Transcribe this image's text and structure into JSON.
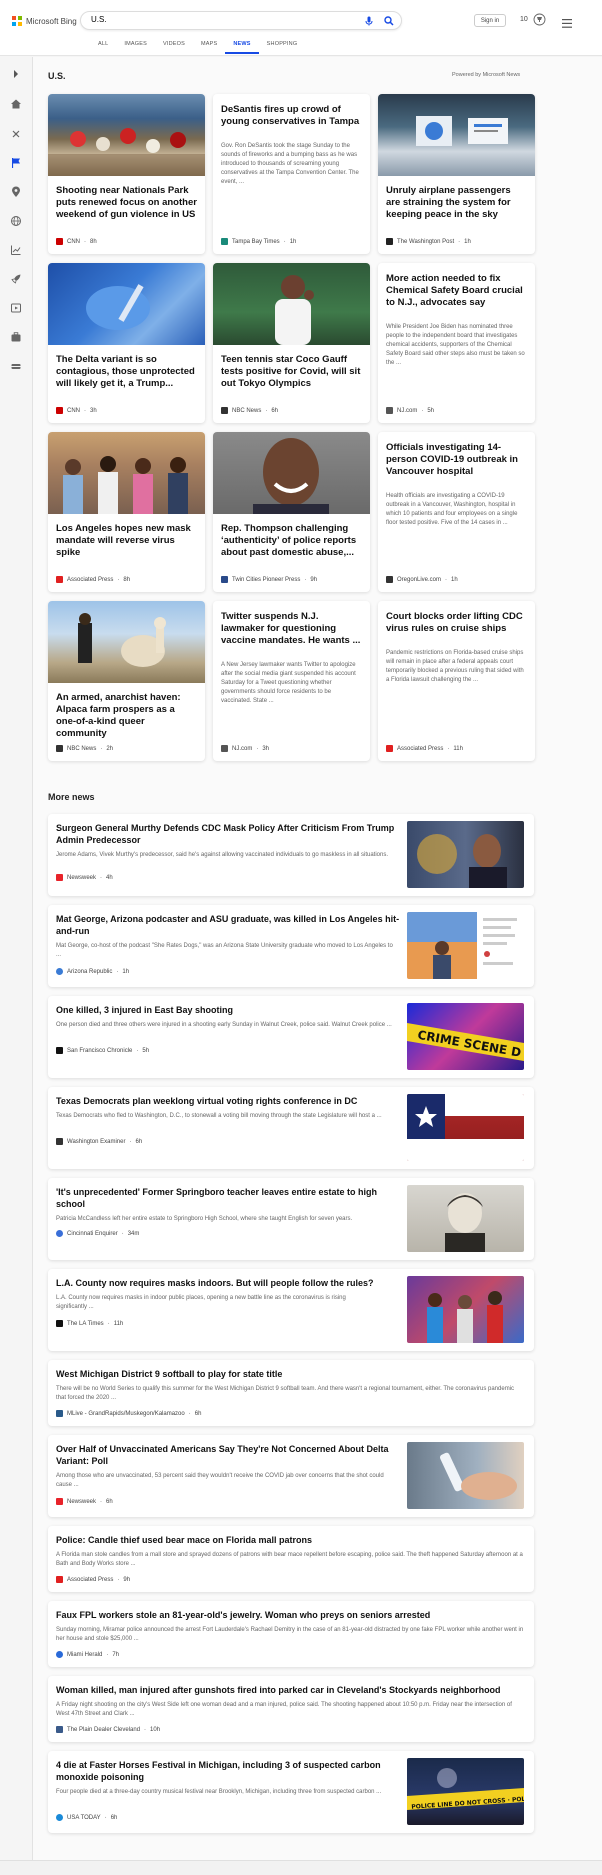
{
  "header": {
    "logo_text": "Microsoft Bing",
    "search_value": "U.S.",
    "signin_label": "Sign in",
    "rewards_count": "10"
  },
  "scopes": [
    "ALL",
    "IMAGES",
    "VIDEOS",
    "MAPS",
    "NEWS",
    "SHOPPING"
  ],
  "active_scope": "NEWS",
  "section": {
    "title": "U.S.",
    "powered_by": "Powered by Microsoft News"
  },
  "cards": [
    {
      "title": "Shooting near Nationals Park puts renewed focus on another weekend of gun violence in US",
      "snippet": "",
      "source": "CNN",
      "time": "8h",
      "fav_color": "#cc0000"
    },
    {
      "title": "DeSantis fires up crowd of young conservatives in Tampa",
      "snippet": "Gov. Ron DeSantis took the stage Sunday to the sounds of fireworks and a bumping bass as he was introduced to thousands of screaming young conservatives at the Tampa Convention Center. The event, ...",
      "source": "Tampa Bay Times",
      "time": "1h",
      "fav_color": "#1a8a7a"
    },
    {
      "title": "Unruly airplane passengers are straining the system for keeping peace in the sky",
      "snippet": "",
      "source": "The Washington Post",
      "time": "1h",
      "fav_color": "#222222"
    },
    {
      "title": "The Delta variant is so contagious, those unprotected will likely get it, a Trump...",
      "snippet": "",
      "source": "CNN",
      "time": "3h",
      "fav_color": "#cc0000"
    },
    {
      "title": "Teen tennis star Coco Gauff tests positive for Covid, will sit out Tokyo Olympics",
      "snippet": "",
      "source": "NBC News",
      "time": "6h",
      "fav_color": "#333333"
    },
    {
      "title": "More action needed to fix Chemical Safety Board crucial to N.J., advocates say",
      "snippet": "While President Joe Biden has nominated three people to the independent board that investigates chemical accidents, supporters of the Chemical Safety Board said other steps also must be taken so the ...",
      "source": "NJ.com",
      "time": "5h",
      "fav_color": "#555555"
    },
    {
      "title": "Los Angeles hopes new mask mandate will reverse virus spike",
      "snippet": "",
      "source": "Associated Press",
      "time": "8h",
      "fav_color": "#e02020"
    },
    {
      "title": "Rep. Thompson challenging ‘authenticity’ of police reports about past domestic abuse,...",
      "snippet": "",
      "source": "Twin Cities Pioneer Press",
      "time": "9h",
      "fav_color": "#2a4a8a"
    },
    {
      "title": "Officials investigating 14-person COVID-19 outbreak in Vancouver hospital",
      "snippet": "Health officials are investigating a COVID-19 outbreak in a Vancouver, Washington, hospital in which 10 patients and four employees on a single floor tested positive. Five of the 14 cases in ...",
      "source": "OregonLive.com",
      "time": "1h",
      "fav_color": "#333333"
    },
    {
      "title": "An armed, anarchist haven: Alpaca farm prospers as a one-of-a-kind queer community",
      "snippet": "",
      "source": "NBC News",
      "time": "2h",
      "fav_color": "#333333"
    },
    {
      "title": "Twitter suspends N.J. lawmaker for questioning vaccine mandates. He wants ...",
      "snippet": "A New Jersey lawmaker wants Twitter to apologize after the social media giant suspended his account Saturday for a Tweet questioning whether governments should force residents to be vaccinated. State ...",
      "source": "NJ.com",
      "time": "3h",
      "fav_color": "#555555"
    },
    {
      "title": "Court blocks order lifting CDC virus rules on cruise ships",
      "snippet": "Pandemic restrictions on Florida-based cruise ships will remain in place after a federal appeals court temporarily blocked a previous ruling that sided with a Florida lawsuit challenging the ...",
      "source": "Associated Press",
      "time": "11h",
      "fav_color": "#e02020"
    }
  ],
  "more_news_title": "More news",
  "more_news": [
    {
      "title": "Surgeon General Murthy Defends CDC Mask Policy After Criticism From Trump Admin Predecessor",
      "snippet": "Jerome Adams, Vivek Murthy's predecessor, said he's against allowing vaccinated individuals to go maskless in all situations.",
      "source": "Newsweek",
      "time": "4h",
      "fav_color": "#e8232a"
    },
    {
      "title": "Mat George, Arizona podcaster and ASU graduate, was killed in Los Angeles hit-and-run",
      "snippet": "Mat George, co-host of the podcast \"She Rates Dogs,\" was an Arizona State University graduate who moved to Los Angeles to ...",
      "source": "Arizona Republic",
      "time": "1h",
      "fav_color": "#3a7bd5"
    },
    {
      "title": "One killed, 3 injured in East Bay shooting",
      "snippet": "One person died and three others were injured in a shooting early Sunday in Walnut Creek, police said. Walnut Creek police ...",
      "source": "San Francisco Chronicle",
      "time": "5h",
      "fav_color": "#111111"
    },
    {
      "title": "Texas Democrats plan weeklong virtual voting rights conference in DC",
      "snippet": "Texas Democrats who fled to Washington, D.C., to stonewall a voting bill moving through the state Legislature will host a ...",
      "source": "Washington Examiner",
      "time": "6h",
      "fav_color": "#333333"
    },
    {
      "title": "'It's unprecedented' Former Springboro teacher leaves entire estate to high school",
      "snippet": "Patricia McCandless left her entire estate to Springboro High School, where she taught English for seven years.",
      "source": "Cincinnati Enquirer",
      "time": "34m",
      "fav_color": "#3a6fd8"
    },
    {
      "title": "L.A. County now requires masks indoors. But will people follow the rules?",
      "snippet": "L.A. County now requires masks in indoor public places, opening a new battle line as the coronavirus is rising significantly ...",
      "source": "The LA Times",
      "time": "11h",
      "fav_color": "#111111"
    },
    {
      "title": "West Michigan District 9 softball to play for state title",
      "snippet": "There will be no World Series to qualify this summer for the West Michigan District 9 softball team. And there wasn't a regional tournament, either. The coronavirus pandemic that forced the 2020 ...",
      "source": "MLive - GrandRapids/Muskegon/Kalamazoo",
      "time": "6h",
      "fav_color": "#2a5a8a"
    },
    {
      "title": "Over Half of Unvaccinated Americans Say They're Not Concerned About Delta Variant: Poll",
      "snippet": "Among those who are unvaccinated, 53 percent said they wouldn't receive the COVID jab over concerns that the shot could cause ...",
      "source": "Newsweek",
      "time": "6h",
      "fav_color": "#e8232a"
    },
    {
      "title": "Police: Candle thief used bear mace on Florida mall patrons",
      "snippet": "A Florida man stole candles from a mall store and sprayed dozens of patrons with bear mace repellent before escaping, police said. The theft happened Saturday afternoon at a Bath and Body Works store ...",
      "source": "Associated Press",
      "time": "9h",
      "fav_color": "#e02020"
    },
    {
      "title": "Faux FPL workers stole an 81-year-old's jewelry. Woman who preys on seniors arrested",
      "snippet": "Sunday morning, Miramar police announced the arrest Fort Lauderdale's Rachael Demitry in the case of an 81-year-old distracted by one fake FPL worker while another went in her house and stole $25,000 ...",
      "source": "Miami Herald",
      "time": "7h",
      "fav_color": "#2a6ad8"
    },
    {
      "title": "Woman killed, man injured after gunshots fired into parked car in Cleveland's Stockyards neighborhood",
      "snippet": "A Friday night shooting on the city's West Side left one woman dead and a man injured, police said. The shooting happened about 10:50 p.m. Friday near the intersection of West 47th Street and Clark ...",
      "source": "The Plain Dealer Cleveland",
      "time": "10h",
      "fav_color": "#3a5a8a"
    },
    {
      "title": "4 die at Faster Horses Festival in Michigan, including 3 of suspected carbon monoxide poisoning",
      "snippet": "Four people died at a three-day country musical festival near Brooklyn, Michigan, including three from suspected carbon ...",
      "source": "USA TODAY",
      "time": "6h",
      "fav_color": "#1a8ad8"
    }
  ],
  "footer": {
    "left_text": "",
    "right_text": ""
  }
}
